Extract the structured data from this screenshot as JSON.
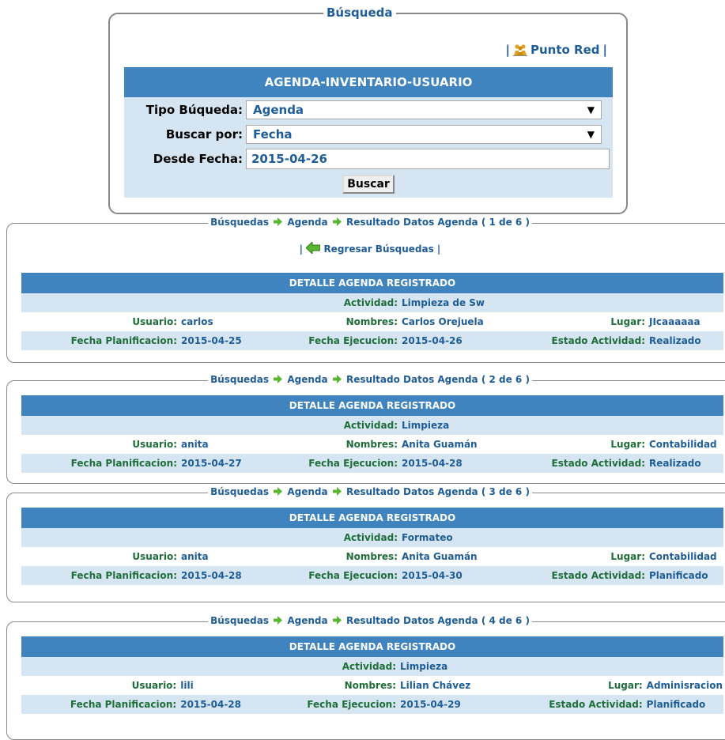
{
  "search": {
    "legend": "Búsqueda",
    "punto_red": "Punto Red",
    "pipe": "|",
    "header": "AGENDA-INVENTARIO-USUARIO",
    "tipo_label": "Tipo Búqueda:",
    "tipo_value": "Agenda",
    "buscar_por_label": "Buscar por:",
    "buscar_por_value": "Fecha",
    "desde_label": "Desde Fecha:",
    "desde_value": "2015-04-26",
    "button": "Buscar"
  },
  "breadcrumb": {
    "busquedas": "Búsquedas",
    "agenda": "Agenda",
    "resultado": "Resultado Datos Agenda"
  },
  "regresar": "Regresar Búsquedas",
  "labels": {
    "detail_header": "DETALLE AGENDA REGISTRADO",
    "actividad": "Actividad:",
    "usuario": "Usuario:",
    "nombres": "Nombres:",
    "lugar": "Lugar:",
    "fecha_plan": "Fecha Planificacion:",
    "fecha_ejec": "Fecha Ejecucion:",
    "estado": "Estado Actividad:"
  },
  "results": [
    {
      "count": "( 1 de 6 )",
      "actividad": "Limpieza de Sw",
      "usuario": "carlos",
      "nombres": "Carlos Orejuela",
      "lugar": "JIcaaaaaa",
      "fecha_plan": "2015-04-25",
      "fecha_ejec": "2015-04-26",
      "estado": "Realizado"
    },
    {
      "count": "( 2 de 6 )",
      "actividad": "Limpieza",
      "usuario": "anita",
      "nombres": "Anita Guamán",
      "lugar": "Contabilidad",
      "fecha_plan": "2015-04-27",
      "fecha_ejec": "2015-04-28",
      "estado": "Realizado"
    },
    {
      "count": "( 3 de 6 )",
      "actividad": "Formateo",
      "usuario": "anita",
      "nombres": "Anita Guamán",
      "lugar": "Contabilidad",
      "fecha_plan": "2015-04-28",
      "fecha_ejec": "2015-04-30",
      "estado": "Planificado"
    },
    {
      "count": "( 4 de 6 )",
      "actividad": "Limpieza",
      "usuario": "lili",
      "nombres": "Lilian Chávez",
      "lugar": "Adminisracion",
      "fecha_plan": "2015-04-28",
      "fecha_ejec": "2015-04-29",
      "estado": "Planificado"
    }
  ],
  "colors": {
    "accent": "#3f83bf",
    "light_row": "#d6e5f2",
    "label_green": "#1f6e3a",
    "value_blue": "#1f5d99"
  }
}
